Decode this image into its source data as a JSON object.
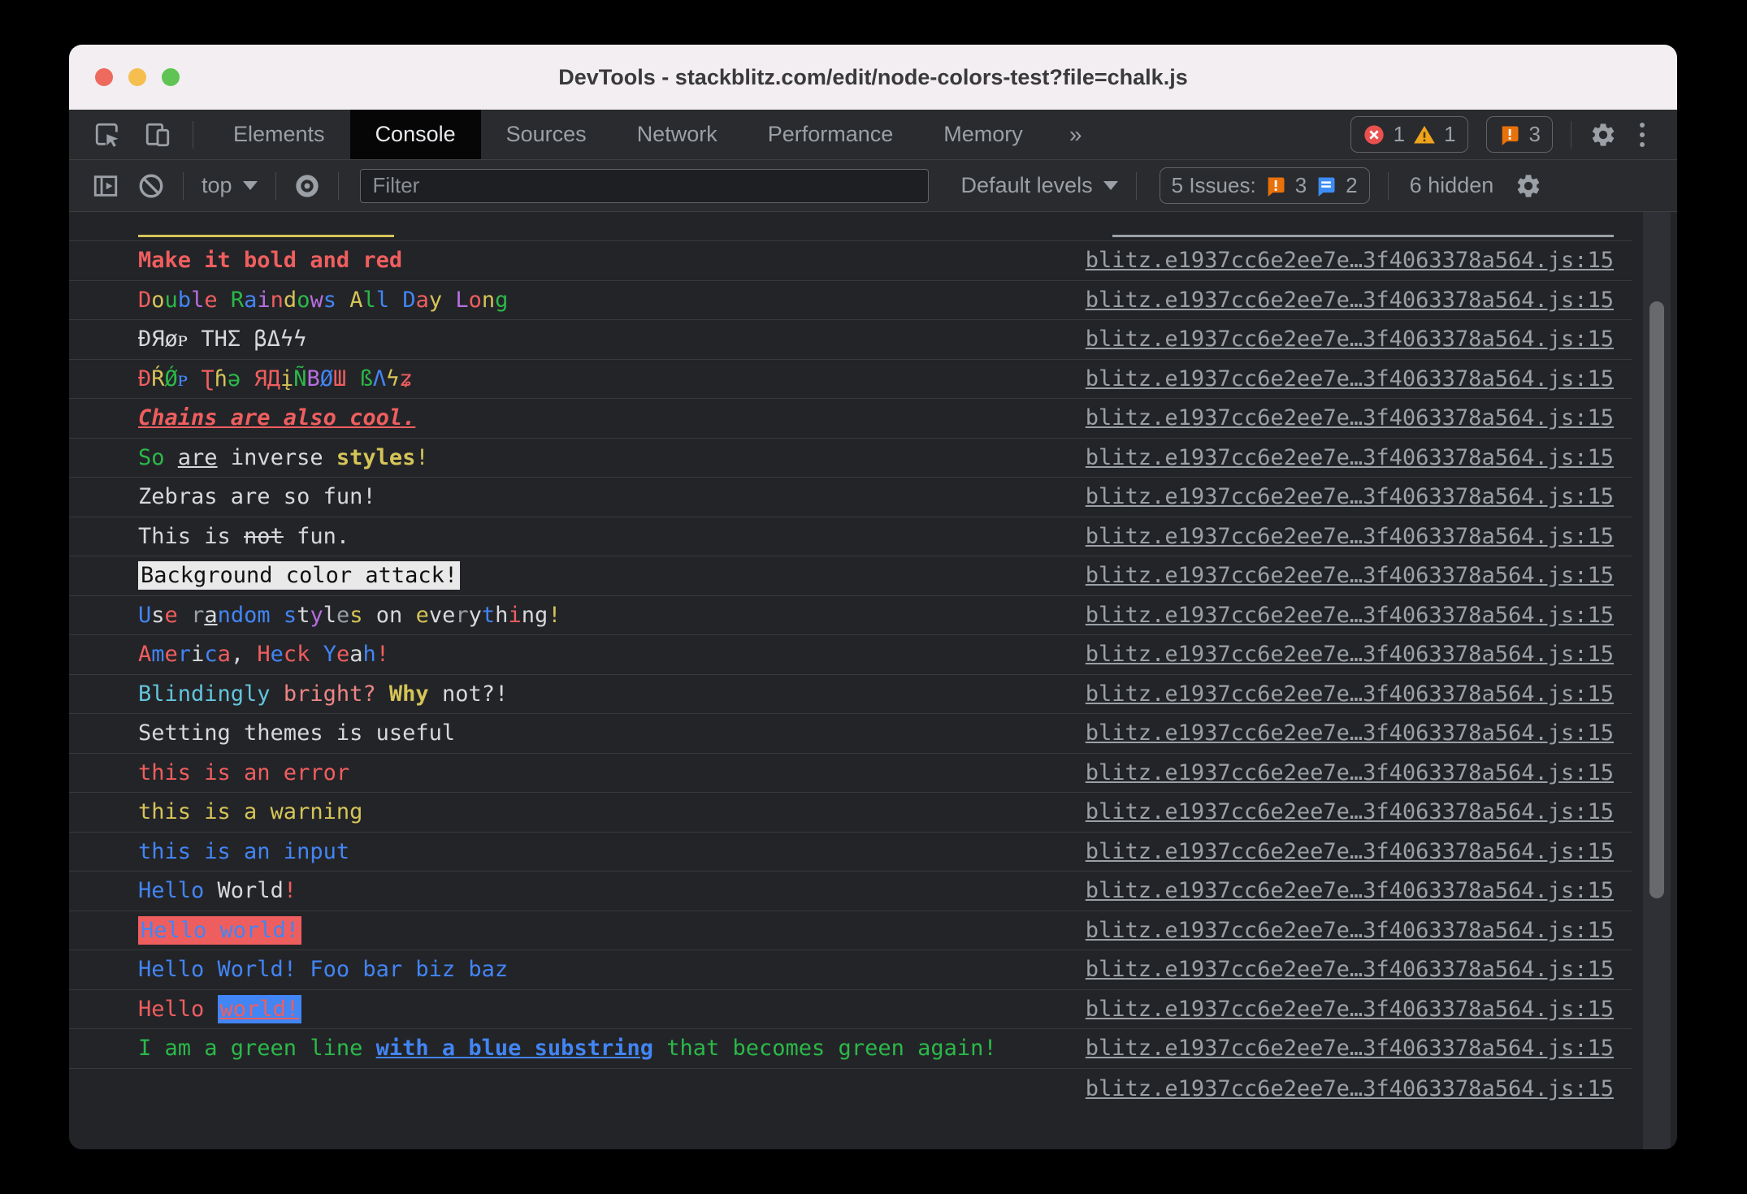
{
  "window": {
    "title": "DevTools - stackblitz.com/edit/node-colors-test?file=chalk.js"
  },
  "tabbar": {
    "tabs": [
      {
        "label": "Elements",
        "active": false
      },
      {
        "label": "Console",
        "active": true
      },
      {
        "label": "Sources",
        "active": false
      },
      {
        "label": "Network",
        "active": false
      },
      {
        "label": "Performance",
        "active": false
      },
      {
        "label": "Memory",
        "active": false
      }
    ],
    "overflow_label": "»",
    "error_count": "1",
    "warning_count": "1",
    "issue_badge_count": "3"
  },
  "toolbar": {
    "context_selector": "top",
    "filter_placeholder": "Filter",
    "levels_selector": "Default levels",
    "issues_summary": "5 Issues:",
    "issues_breaking_count": "3",
    "issues_improvement_count": "2",
    "hidden_count": "6 hidden"
  },
  "colors": {
    "red": "#ef5e5e",
    "green": "#2bb949",
    "yellow": "#d5c457",
    "blue": "#4285f4",
    "magenta": "#b76ee0",
    "cyan": "#63c5dc",
    "pink": "#ed8585",
    "fg": "#d6d8db",
    "gray": "#9aa0a6",
    "black": "#111111",
    "white_bg": "#e9e9e9"
  },
  "console": {
    "source_link": "blitz.e1937cc6e2ee7e…3f4063378a564.js:15",
    "rows": [
      {
        "clip": "top"
      },
      {
        "segments": [
          {
            "t": "Make it bold and red",
            "c": "red",
            "b": 1
          }
        ]
      },
      {
        "segments": [
          {
            "t": "D",
            "c": "red"
          },
          {
            "t": "o",
            "c": "yellow"
          },
          {
            "t": "u",
            "c": "green"
          },
          {
            "t": "b",
            "c": "blue"
          },
          {
            "t": "l",
            "c": "magenta"
          },
          {
            "t": "e",
            "c": "red"
          },
          {
            "t": " "
          },
          {
            "t": "R",
            "c": "green"
          },
          {
            "t": "a",
            "c": "blue"
          },
          {
            "t": "i",
            "c": "magenta"
          },
          {
            "t": "n",
            "c": "red"
          },
          {
            "t": "d",
            "c": "yellow"
          },
          {
            "t": "o",
            "c": "green"
          },
          {
            "t": "w",
            "c": "magenta"
          },
          {
            "t": "s",
            "c": "blue"
          },
          {
            "t": " "
          },
          {
            "t": "A",
            "c": "yellow"
          },
          {
            "t": "l",
            "c": "green"
          },
          {
            "t": "l",
            "c": "blue"
          },
          {
            "t": " "
          },
          {
            "t": "D",
            "c": "blue"
          },
          {
            "t": "a",
            "c": "red"
          },
          {
            "t": "y",
            "c": "yellow"
          },
          {
            "t": " "
          },
          {
            "t": "L",
            "c": "magenta"
          },
          {
            "t": "o",
            "c": "red"
          },
          {
            "t": "n",
            "c": "yellow"
          },
          {
            "t": "g",
            "c": "green"
          }
        ]
      },
      {
        "segments": [
          {
            "t": "ÐЯøᴘ ΤΗΣ βΔϟϟ",
            "c": "fg"
          }
        ]
      },
      {
        "segments": [
          {
            "t": "Ð",
            "c": "red"
          },
          {
            "t": "Ŕ",
            "c": "yellow"
          },
          {
            "t": "Ǿ",
            "c": "green"
          },
          {
            "t": "ᴘ",
            "c": "blue"
          },
          {
            "t": " "
          },
          {
            "t": "Ʈ",
            "c": "red"
          },
          {
            "t": "ɦ",
            "c": "yellow"
          },
          {
            "t": "ə",
            "c": "green"
          },
          {
            "t": " "
          },
          {
            "t": "Я",
            "c": "red"
          },
          {
            "t": "Д",
            "c": "red"
          },
          {
            "t": "į",
            "c": "yellow"
          },
          {
            "t": "Ñ",
            "c": "green"
          },
          {
            "t": "B",
            "c": "magenta"
          },
          {
            "t": "Ø",
            "c": "blue"
          },
          {
            "t": "Ш",
            "c": "red"
          },
          {
            "t": " "
          },
          {
            "t": "ß",
            "c": "green"
          },
          {
            "t": "Λ",
            "c": "blue"
          },
          {
            "t": "ϟ",
            "c": "yellow"
          },
          {
            "t": "ʑ",
            "c": "red"
          }
        ]
      },
      {
        "segments": [
          {
            "t": "Chains are also cool.",
            "c": "red",
            "b": 1,
            "i": 1,
            "u": 1
          }
        ]
      },
      {
        "segments": [
          {
            "t": "So",
            "c": "green"
          },
          {
            "t": " ",
            "c": "fg"
          },
          {
            "t": "are",
            "c": "fg",
            "u": 1
          },
          {
            "t": " inverse ",
            "c": "fg"
          },
          {
            "t": "styles",
            "c": "yellow",
            "b": 1
          },
          {
            "t": "!",
            "c": "yellow"
          }
        ]
      },
      {
        "segments": [
          {
            "t": "Zebras are so fun!",
            "c": "fg"
          }
        ]
      },
      {
        "segments": [
          {
            "t": "This is ",
            "c": "fg"
          },
          {
            "t": "not",
            "c": "fg",
            "s": 1
          },
          {
            "t": " fun.",
            "c": "fg"
          }
        ]
      },
      {
        "segments": [
          {
            "t": "Background color attack!",
            "c": "black",
            "bg": "white_bg"
          }
        ]
      },
      {
        "segments": [
          {
            "t": "U",
            "c": "blue"
          },
          {
            "t": "s",
            "c": "fg"
          },
          {
            "t": "e",
            "c": "red"
          },
          {
            "t": " "
          },
          {
            "t": "r",
            "c": "gray"
          },
          {
            "t": "a",
            "c": "fg",
            "u": 1
          },
          {
            "t": "n",
            "c": "blue"
          },
          {
            "t": "d",
            "c": "blue"
          },
          {
            "t": "o",
            "c": "blue"
          },
          {
            "t": "m",
            "c": "blue"
          },
          {
            "t": " "
          },
          {
            "t": "s",
            "c": "blue"
          },
          {
            "t": "t",
            "c": "fg"
          },
          {
            "t": "y",
            "c": "magenta"
          },
          {
            "t": "l",
            "c": "fg"
          },
          {
            "t": "e",
            "c": "gray"
          },
          {
            "t": "s",
            "c": "yellow"
          },
          {
            "t": " "
          },
          {
            "t": "o",
            "c": "fg"
          },
          {
            "t": "n",
            "c": "fg"
          },
          {
            "t": " "
          },
          {
            "t": "e",
            "c": "yellow"
          },
          {
            "t": "v",
            "c": "fg"
          },
          {
            "t": "e",
            "c": "fg"
          },
          {
            "t": "r",
            "c": "gray"
          },
          {
            "t": "y",
            "c": "fg"
          },
          {
            "t": "t",
            "c": "blue"
          },
          {
            "t": "h",
            "c": "fg"
          },
          {
            "t": "i",
            "c": "red"
          },
          {
            "t": "n",
            "c": "fg"
          },
          {
            "t": "g",
            "c": "fg"
          },
          {
            "t": "!",
            "c": "yellow"
          }
        ]
      },
      {
        "segments": [
          {
            "t": "A",
            "c": "red"
          },
          {
            "t": "m",
            "c": "blue"
          },
          {
            "t": "e",
            "c": "red"
          },
          {
            "t": "r",
            "c": "blue"
          },
          {
            "t": "i",
            "c": "fg"
          },
          {
            "t": "c",
            "c": "blue"
          },
          {
            "t": "a",
            "c": "red"
          },
          {
            "t": ",",
            "c": "fg"
          },
          {
            "t": " "
          },
          {
            "t": "H",
            "c": "red"
          },
          {
            "t": "e",
            "c": "blue"
          },
          {
            "t": "c",
            "c": "red"
          },
          {
            "t": "k",
            "c": "red"
          },
          {
            "t": " "
          },
          {
            "t": "Y",
            "c": "blue"
          },
          {
            "t": "e",
            "c": "red"
          },
          {
            "t": "a",
            "c": "fg"
          },
          {
            "t": "h",
            "c": "blue"
          },
          {
            "t": "!",
            "c": "red"
          }
        ]
      },
      {
        "segments": [
          {
            "t": "Blindingly",
            "c": "cyan"
          },
          {
            "t": " ",
            "c": "fg"
          },
          {
            "t": "bright?",
            "c": "pink"
          },
          {
            "t": " ",
            "c": "fg"
          },
          {
            "t": "Why",
            "c": "yellow",
            "b": 1
          },
          {
            "t": " ",
            "c": "fg"
          },
          {
            "t": "not?!",
            "c": "fg"
          }
        ]
      },
      {
        "segments": [
          {
            "t": "Setting themes is useful",
            "c": "fg"
          }
        ]
      },
      {
        "segments": [
          {
            "t": "this is an error",
            "c": "red"
          }
        ]
      },
      {
        "segments": [
          {
            "t": "this is a warning",
            "c": "yellow"
          }
        ]
      },
      {
        "segments": [
          {
            "t": "this is an input",
            "c": "blue"
          }
        ]
      },
      {
        "segments": [
          {
            "t": "Hello",
            "c": "blue"
          },
          {
            "t": " ",
            "c": "fg"
          },
          {
            "t": "World",
            "c": "fg"
          },
          {
            "t": "!",
            "c": "red"
          }
        ]
      },
      {
        "segments": [
          {
            "t": "Hello world!",
            "c": "blue",
            "bg": "red"
          }
        ]
      },
      {
        "segments": [
          {
            "t": "Hello World! Foo bar biz baz",
            "c": "blue"
          }
        ]
      },
      {
        "segments": [
          {
            "t": "Hello ",
            "c": "red"
          },
          {
            "t": "world!",
            "c": "red",
            "u": 1,
            "bg": "blue"
          }
        ]
      },
      {
        "segments": [
          {
            "t": "I am a green line ",
            "c": "green"
          },
          {
            "t": "with a blue substring",
            "c": "blue",
            "b": 1,
            "u": 1
          },
          {
            "t": " that becomes green again!",
            "c": "green"
          }
        ]
      },
      {
        "clip": "bottom"
      }
    ]
  }
}
